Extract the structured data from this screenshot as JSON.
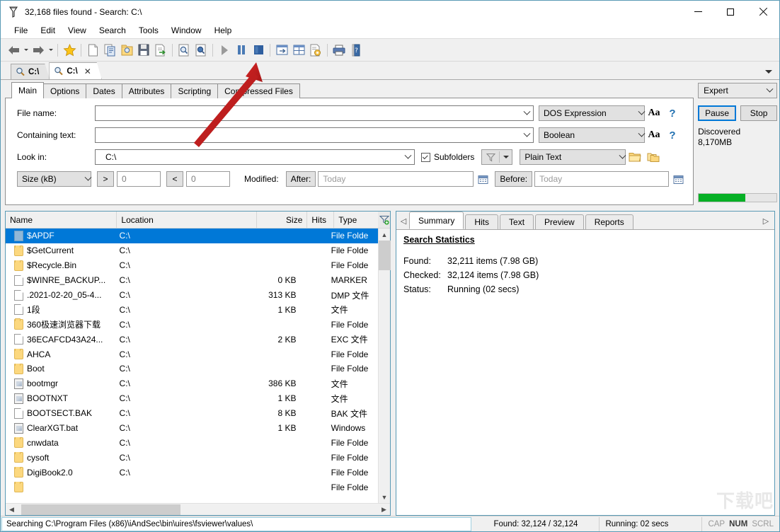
{
  "window": {
    "title": "32,168 files found - Search: C:\\",
    "app_icon": "search-funnel-icon",
    "minimize": "–",
    "maximize": "□",
    "close": "×"
  },
  "menu": {
    "items": [
      "File",
      "Edit",
      "View",
      "Search",
      "Tools",
      "Window",
      "Help"
    ]
  },
  "toolbar": {
    "buttons": [
      {
        "name": "back-icon",
        "glyph": "←"
      },
      {
        "name": "forward-icon",
        "glyph": "→"
      },
      {
        "name": "favorites-star-icon",
        "glyph": "★"
      },
      {
        "name": "new-search-icon",
        "glyph": "▭"
      },
      {
        "name": "copy-search-icon",
        "glyph": "▤"
      },
      {
        "name": "open-search-icon",
        "glyph": "▣"
      },
      {
        "name": "save-search-icon",
        "glyph": "▬"
      },
      {
        "name": "export-icon",
        "glyph": "▤"
      },
      {
        "name": "preview-search-icon",
        "glyph": "▥"
      },
      {
        "name": "inspect-icon",
        "glyph": "▦"
      },
      {
        "name": "start-search-icon",
        "glyph": "▶"
      },
      {
        "name": "pause-search-icon",
        "glyph": "❚❚"
      },
      {
        "name": "stop-search-icon",
        "glyph": "■"
      },
      {
        "name": "layout-panel-icon",
        "glyph": "▤"
      },
      {
        "name": "layout-split-icon",
        "glyph": "▥"
      },
      {
        "name": "options-icon",
        "glyph": "▦"
      },
      {
        "name": "print-icon",
        "glyph": "⎙"
      },
      {
        "name": "help-book-icon",
        "glyph": "❓"
      }
    ]
  },
  "search_tabs": {
    "tabs": [
      {
        "label": "C:\\",
        "active": false,
        "closable": false
      },
      {
        "label": "C:\\",
        "active": true,
        "closable": true,
        "close": "✕"
      }
    ],
    "expander": "▼"
  },
  "criteria": {
    "tabs": [
      "Main",
      "Options",
      "Dates",
      "Attributes",
      "Scripting",
      "Compressed Files"
    ],
    "active_tab": "Main",
    "fields": {
      "file_name_label": "File name:",
      "file_name_value": "",
      "file_name_mode": "DOS Expression",
      "containing_text_label": "Containing text:",
      "containing_text_value": "",
      "containing_text_mode": "Boolean",
      "look_in_label": "Look in:",
      "look_in_value": "C:\\",
      "subfolders_label": "Subfolders",
      "subfolders_checked": true,
      "text_mode": "Plain Text",
      "size_unit": "Size (kB)",
      "size_gt_op": ">",
      "size_gt_value": "0",
      "size_lt_op": "<",
      "size_lt_value": "0",
      "modified_label": "Modified:",
      "after_label": "After:",
      "after_value": "Today",
      "before_label": "Before:",
      "before_value": "Today"
    },
    "icon_buttons": {
      "match_case": "Aa",
      "help": "?",
      "browse_folder": "folder-icon",
      "browse_multi_folder": "multi-folder-icon",
      "filter": "filter-funnel-icon",
      "filter_dropdown": "chevron-down-icon",
      "calendar": "calendar-icon"
    }
  },
  "controls": {
    "mode": "Expert",
    "pause_label": "Pause",
    "stop_label": "Stop",
    "discovered_label": "Discovered",
    "discovered_value": "8,170MB",
    "progress_percent": 60,
    "progress_color": "#06b025"
  },
  "file_list": {
    "columns": [
      {
        "label": "Name",
        "align": "left"
      },
      {
        "label": "Location",
        "align": "left"
      },
      {
        "label": "Size",
        "align": "right"
      },
      {
        "label": "Hits",
        "align": "left"
      },
      {
        "label": "Type",
        "align": "left"
      }
    ],
    "filter_icon": "filter-add-icon",
    "rows": [
      {
        "name": "$APDF",
        "location": "C:\\",
        "size": "",
        "hits": "",
        "type": "File Folde",
        "icon": "folder",
        "selected": true
      },
      {
        "name": "$GetCurrent",
        "location": "C:\\",
        "size": "",
        "hits": "",
        "type": "File Folde",
        "icon": "folder",
        "selected": false
      },
      {
        "name": "$Recycle.Bin",
        "location": "C:\\",
        "size": "",
        "hits": "",
        "type": "File Folde",
        "icon": "folder",
        "selected": false
      },
      {
        "name": "$WINRE_BACKUP...",
        "location": "C:\\",
        "size": "0 KB",
        "hits": "",
        "type": "MARKER",
        "icon": "file",
        "selected": false
      },
      {
        "name": ".2021-02-20_05-4...",
        "location": "C:\\",
        "size": "313 KB",
        "hits": "",
        "type": "DMP 文件",
        "icon": "file",
        "selected": false
      },
      {
        "name": "1段",
        "location": "C:\\",
        "size": "1 KB",
        "hits": "",
        "type": "文件",
        "icon": "file",
        "selected": false
      },
      {
        "name": "360极速浏览器下载",
        "location": "C:\\",
        "size": "",
        "hits": "",
        "type": "File Folde",
        "icon": "folder",
        "selected": false
      },
      {
        "name": "36ECAFCD43A24...",
        "location": "C:\\",
        "size": "2 KB",
        "hits": "",
        "type": "EXC 文件",
        "icon": "file",
        "selected": false
      },
      {
        "name": "AHCA",
        "location": "C:\\",
        "size": "",
        "hits": "",
        "type": "File Folde",
        "icon": "folder",
        "selected": false
      },
      {
        "name": "Boot",
        "location": "C:\\",
        "size": "",
        "hits": "",
        "type": "File Folde",
        "icon": "folder",
        "selected": false
      },
      {
        "name": "bootmgr",
        "location": "C:\\",
        "size": "386 KB",
        "hits": "",
        "type": "文件",
        "icon": "sysfile",
        "selected": false
      },
      {
        "name": "BOOTNXT",
        "location": "C:\\",
        "size": "1 KB",
        "hits": "",
        "type": "文件",
        "icon": "sysfile",
        "selected": false
      },
      {
        "name": "BOOTSECT.BAK",
        "location": "C:\\",
        "size": "8 KB",
        "hits": "",
        "type": "BAK 文件",
        "icon": "file",
        "selected": false
      },
      {
        "name": "ClearXGT.bat",
        "location": "C:\\",
        "size": "1 KB",
        "hits": "",
        "type": "Windows",
        "icon": "sysfile",
        "selected": false
      },
      {
        "name": "cnwdata",
        "location": "C:\\",
        "size": "",
        "hits": "",
        "type": "File Folde",
        "icon": "folder",
        "selected": false
      },
      {
        "name": "cysoft",
        "location": "C:\\",
        "size": "",
        "hits": "",
        "type": "File Folde",
        "icon": "folder",
        "selected": false
      },
      {
        "name": "DigiBook2.0",
        "location": "C:\\",
        "size": "",
        "hits": "",
        "type": "File Folde",
        "icon": "folder",
        "selected": false
      },
      {
        "name": "",
        "location": "",
        "size": "",
        "hits": "",
        "type": "File Folde",
        "icon": "folder",
        "selected": false
      }
    ]
  },
  "preview": {
    "tabs": [
      "Summary",
      "Hits",
      "Text",
      "Preview",
      "Reports"
    ],
    "active_tab": "Summary",
    "scroll_left": "◁",
    "scroll_right": "▷",
    "summary": {
      "title": "Search Statistics",
      "rows": [
        {
          "label": "Found:",
          "value": "32,211 items (7.98 GB)"
        },
        {
          "label": "Checked:",
          "value": "32,124 items (7.98 GB)"
        },
        {
          "label": "Status:",
          "value": "Running (02 secs)"
        }
      ]
    }
  },
  "statusbar": {
    "message": "Searching C:\\Program Files (x86)\\iAndSec\\bin\\uires\\fsviewer\\values\\",
    "found": "Found: 32,124 / 32,124",
    "running": "Running: 02 secs",
    "keys": [
      {
        "label": "CAP",
        "active": false
      },
      {
        "label": "NUM",
        "active": true
      },
      {
        "label": "SCRL",
        "active": false
      }
    ]
  },
  "watermark": "下载吧"
}
